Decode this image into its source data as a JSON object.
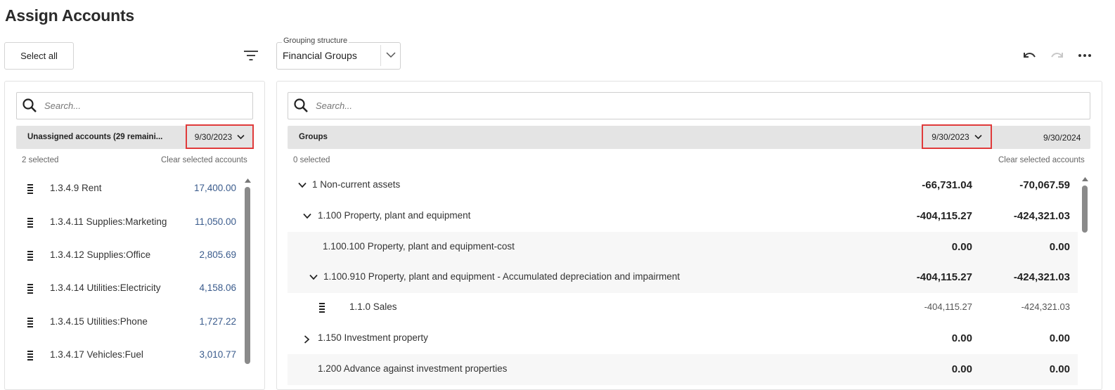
{
  "page": {
    "title": "Assign Accounts"
  },
  "toolbar": {
    "select_all_label": "Select all",
    "grouping_legend": "Grouping structure",
    "grouping_value": "Financial Groups"
  },
  "left_panel": {
    "search_placeholder": "Search...",
    "header_label": "Unassigned accounts (29 remaini...",
    "date": "9/30/2023",
    "selected_count": "2 selected",
    "clear_label": "Clear selected accounts",
    "accounts": [
      {
        "label": "1.3.4.9 Rent",
        "value": "17,400.00"
      },
      {
        "label": "1.3.4.11 Supplies:Marketing",
        "value": "11,050.00"
      },
      {
        "label": "1.3.4.12 Supplies:Office",
        "value": "2,805.69"
      },
      {
        "label": "1.3.4.14 Utilities:Electricity",
        "value": "4,158.06"
      },
      {
        "label": "1.3.4.15 Utilities:Phone",
        "value": "1,727.22"
      },
      {
        "label": "1.3.4.17 Vehicles:Fuel",
        "value": "3,010.77"
      }
    ]
  },
  "right_panel": {
    "search_placeholder": "Search...",
    "header_label": "Groups",
    "date_1": "9/30/2023",
    "date_2": "9/30/2024",
    "selected_count": "0 selected",
    "clear_label": "Clear selected accounts",
    "groups": [
      {
        "label": "1 Non-current assets",
        "v1": "-66,731.04",
        "v2": "-70,067.59"
      },
      {
        "label": "1.100 Property, plant and equipment",
        "v1": "-404,115.27",
        "v2": "-424,321.03"
      },
      {
        "label": "1.100.100 Property, plant and equipment-cost",
        "v1": "0.00",
        "v2": "0.00"
      },
      {
        "label": "1.100.910 Property, plant and equipment - Accumulated depreciation and impairment",
        "v1": "-404,115.27",
        "v2": "-424,321.03"
      },
      {
        "label": "1.1.0 Sales",
        "v1": "-404,115.27",
        "v2": "-424,321.03"
      },
      {
        "label": "1.150 Investment property",
        "v1": "0.00",
        "v2": "0.00"
      },
      {
        "label": "1.200 Advance against investment properties",
        "v1": "0.00",
        "v2": "0.00"
      }
    ]
  },
  "icons": {
    "search": "search-icon",
    "filter": "filter-icon",
    "undo": "undo-icon",
    "redo": "redo-icon",
    "more": "more-icon",
    "chevron": "chevron-down-icon",
    "drag": "drag-handle-icon"
  },
  "colors": {
    "highlight_border": "#e03a3a",
    "account_value": "#3a5b8c",
    "header_bg": "#e4e4e4"
  }
}
